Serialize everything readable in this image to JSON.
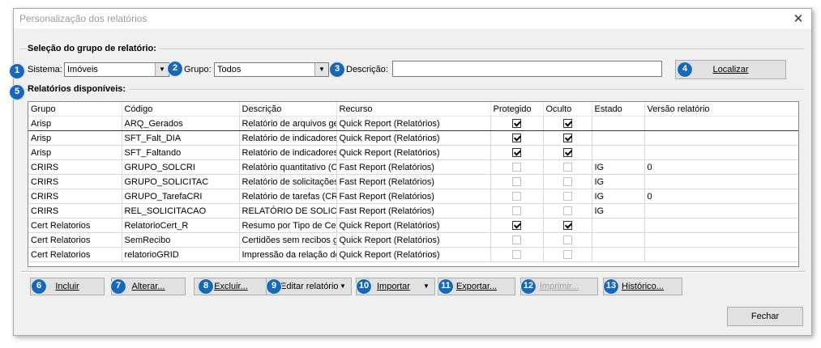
{
  "window": {
    "title": "Personalização dos relatórios",
    "close_glyph": "✕"
  },
  "selection": {
    "group_title": "Seleção do grupo de relatório:",
    "sistema_label": "Sistema:",
    "sistema_value": "Imóveis",
    "grupo_label": "Grupo:",
    "grupo_value": "Todos",
    "descricao_label": "Descrição:",
    "descricao_value": "",
    "localizar_label": "Localizar"
  },
  "reports": {
    "group_title": "Relatórios disponíveis:",
    "columns": [
      "Grupo",
      "Código",
      "Descrição",
      "Recurso",
      "Protegido",
      "Oculto",
      "Estado",
      "Versão relatório"
    ],
    "rows": [
      {
        "grupo": "Arisp",
        "codigo": "ARQ_Gerados",
        "descricao": "Relatório de arquivos ge",
        "recurso": "Quick Report (Relatórios)",
        "protegido": true,
        "oculto": true,
        "estado": "",
        "versao": ""
      },
      {
        "grupo": "Arisp",
        "codigo": "SFT_Falt_DIA",
        "descricao": "Relatório de indicadores",
        "recurso": "Quick Report (Relatórios)",
        "protegido": true,
        "oculto": true,
        "estado": "",
        "versao": ""
      },
      {
        "grupo": "Arisp",
        "codigo": "SFT_Faltando",
        "descricao": "Relatório de indicadores",
        "recurso": "Quick Report (Relatórios)",
        "protegido": true,
        "oculto": true,
        "estado": "",
        "versao": ""
      },
      {
        "grupo": "CRIRS",
        "codigo": "GRUPO_SOLCRI",
        "descricao": "Relatório quantitativo (Cl",
        "recurso": "Fast Report (Relatórios)",
        "protegido": false,
        "oculto": false,
        "estado": "IG",
        "versao": "0"
      },
      {
        "grupo": "CRIRS",
        "codigo": "GRUPO_SOLICITAC",
        "descricao": "Relatório de solicitações",
        "recurso": "Fast Report (Relatórios)",
        "protegido": false,
        "oculto": false,
        "estado": "IG",
        "versao": ""
      },
      {
        "grupo": "CRIRS",
        "codigo": "GRUPO_TarefaCRI",
        "descricao": "Relatório de tarefas (CRI",
        "recurso": "Fast Report (Relatórios)",
        "protegido": false,
        "oculto": false,
        "estado": "IG",
        "versao": "0"
      },
      {
        "grupo": "CRIRS",
        "codigo": "REL_SOLICITACAO",
        "descricao": "RELATÓRIO DE SOLIC",
        "recurso": "Fast Report (Relatórios)",
        "protegido": false,
        "oculto": false,
        "estado": "IG",
        "versao": ""
      },
      {
        "grupo": "Cert Relatorios",
        "codigo": "RelatorioCert_R",
        "descricao": "Resumo por Tipo de Cer",
        "recurso": "Quick Report (Relatórios)",
        "protegido": true,
        "oculto": true,
        "estado": "",
        "versao": ""
      },
      {
        "grupo": "Cert Relatorios",
        "codigo": "SemRecibo",
        "descricao": "Certidões sem recibos ge",
        "recurso": "Quick Report (Relatórios)",
        "protegido": false,
        "oculto": false,
        "estado": "",
        "versao": ""
      },
      {
        "grupo": "Cert Relatorios",
        "codigo": "relatorioGRID",
        "descricao": "Impressão da relação de",
        "recurso": "Quick Report (Relatórios)",
        "protegido": false,
        "oculto": false,
        "estado": "",
        "versao": ""
      }
    ]
  },
  "actions": {
    "incluir": "Incluir",
    "alterar": "Alterar...",
    "excluir": "Excluir...",
    "editar": "Editar relatório",
    "importar": "Importar",
    "exportar": "Exportar...",
    "imprimir": "Imprimir...",
    "historico": "Histórico...",
    "fechar": "Fechar",
    "dropdown_glyph": "▼"
  },
  "badges": [
    "1",
    "2",
    "3",
    "4",
    "5",
    "6",
    "7",
    "8",
    "9",
    "10",
    "11",
    "12",
    "13"
  ],
  "colors": {
    "badge": "#1768b8",
    "window_bg": "#f0f0f0"
  }
}
